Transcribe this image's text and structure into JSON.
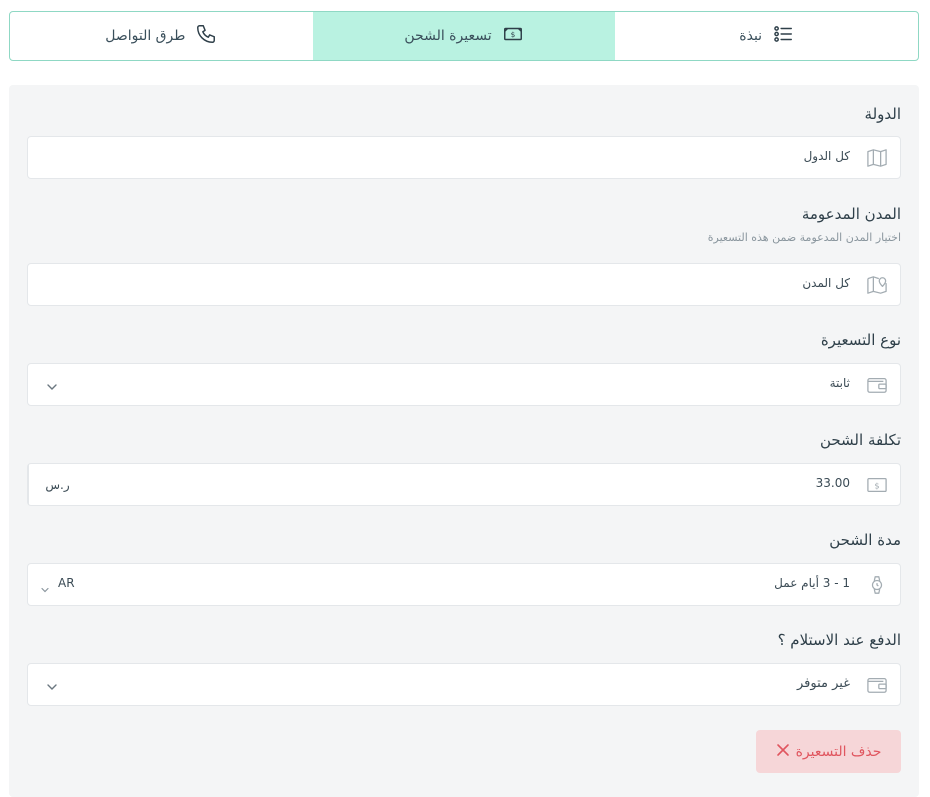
{
  "tabs": [
    {
      "label": "نبذة",
      "icon": "list-icon",
      "active": false
    },
    {
      "label": "تسعيرة الشحن",
      "icon": "money-icon",
      "active": true
    },
    {
      "label": "طرق التواصل",
      "icon": "phone-icon",
      "active": false
    }
  ],
  "form": {
    "country": {
      "label": "الدولة",
      "value": "كل الدول",
      "icon": "map-icon"
    },
    "cities": {
      "label": "المدن المدعومة",
      "hint": "اختيار المدن المدعومة ضمن هذه التسعيرة",
      "value": "كل المدن",
      "icon": "map-pin-icon"
    },
    "pricing_type": {
      "label": "نوع التسعيرة",
      "value": "ثابتة",
      "icon": "wallet-icon"
    },
    "shipping_cost": {
      "label": "تكلفة الشحن",
      "value": "33.00",
      "suffix": "ر.س",
      "icon": "money-icon"
    },
    "shipping_duration": {
      "label": "مدة الشحن",
      "value": "1 - 3 أيام عمل",
      "lang": "AR",
      "icon": "watch-icon"
    },
    "cod": {
      "label": "الدفع عند الاستلام ؟",
      "value": "غير متوفر",
      "icon": "wallet-icon"
    }
  },
  "delete_button": {
    "label": "حذف التسعيرة",
    "icon": "close-icon"
  },
  "colors": {
    "accent": "#b9f2e1",
    "border": "#8fd8c4",
    "danger": "#e0565f",
    "danger_bg": "#f6d6d8"
  }
}
